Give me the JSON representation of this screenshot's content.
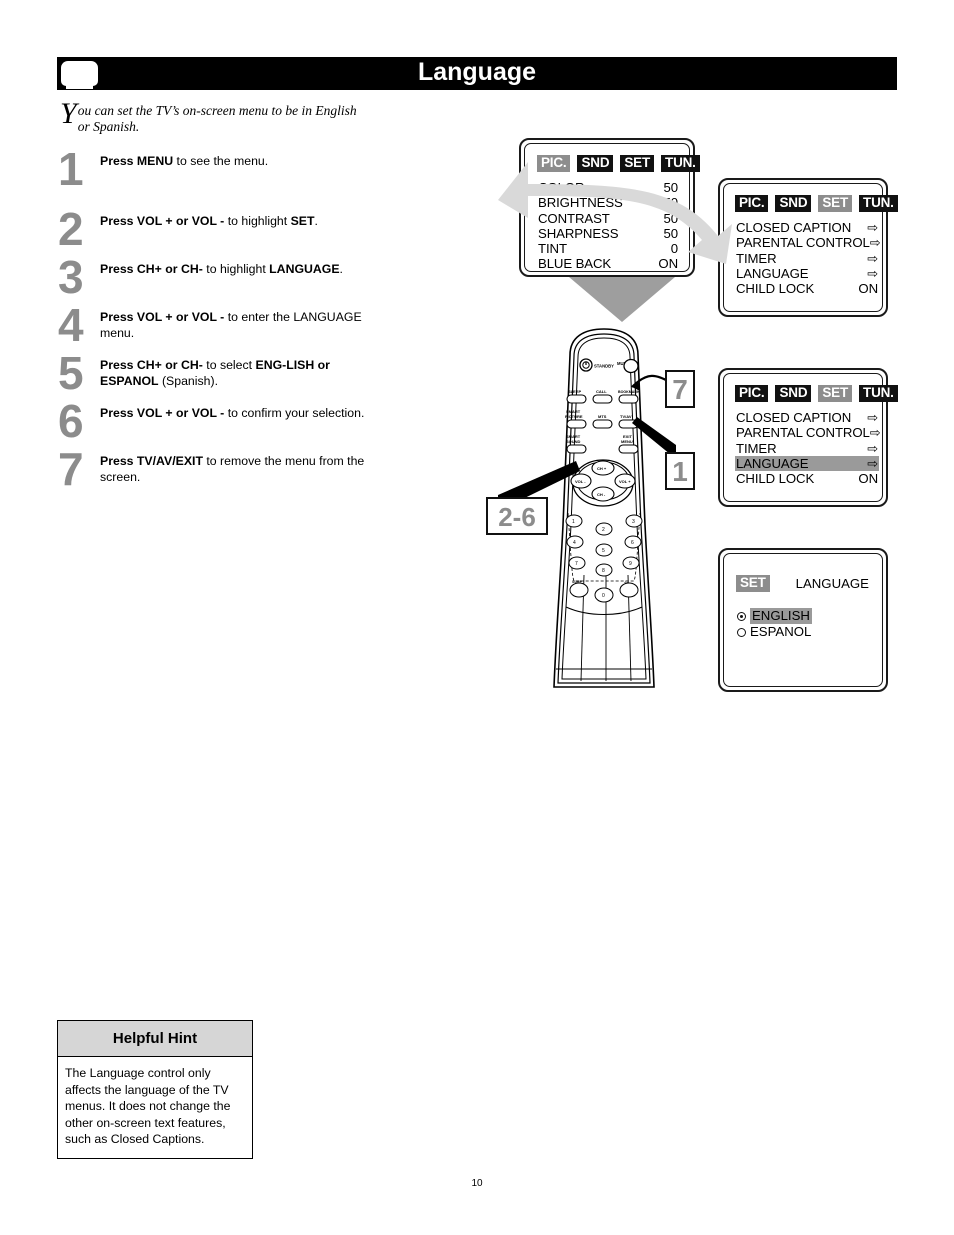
{
  "header": {
    "title": "Language",
    "tv_icon": "tv-icon"
  },
  "intro": {
    "dropcap": "Y",
    "text": "ou can set the TV’s on-screen menu to be in English or Spanish."
  },
  "steps": [
    {
      "num": "1",
      "html": "<b>Press MENU</b> to see the menu."
    },
    {
      "num": "2",
      "html": "<b>Press VOL + or VOL -</b> to highlight <b>SET</b>."
    },
    {
      "num": "3",
      "html": "<b>Press CH+ or CH-</b> to highlight <b>LANGUAGE</b>."
    },
    {
      "num": "4",
      "html": "<b>Press VOL + or VOL -</b> to enter the LANGUAGE menu."
    },
    {
      "num": "5",
      "html": "<b>Press CH+ or CH-</b> to select <b>ENG-LISH or ESPANOL</b> (Spanish)."
    },
    {
      "num": "6",
      "html": "<b>Press VOL + or VOL -</b> to confirm your selection."
    },
    {
      "num": "7",
      "html": "<b>Press TV/AV/EXIT</b> to remove the menu from the screen."
    }
  ],
  "osd": {
    "tabs": [
      "PIC.",
      "SND",
      "SET",
      "TUN."
    ],
    "picture_menu": {
      "selected_tab": "PIC.",
      "rows": [
        {
          "label": "COLOR",
          "value": "50"
        },
        {
          "label": "BRIGHTNESS",
          "value": "50"
        },
        {
          "label": "CONTRAST",
          "value": "50"
        },
        {
          "label": "SHARPNESS",
          "value": "50"
        },
        {
          "label": "TINT",
          "value": "0"
        },
        {
          "label": "BLUE BACK",
          "value": "ON"
        }
      ]
    },
    "set_menu": {
      "selected_tab": "SET",
      "rows": [
        {
          "label": "CLOSED CAPTION",
          "value": "⇨"
        },
        {
          "label": "PARENTAL CONTROL",
          "value": "⇨"
        },
        {
          "label": "TIMER",
          "value": "⇨"
        },
        {
          "label": "LANGUAGE",
          "value": "⇨"
        },
        {
          "label": "CHILD LOCK",
          "value": "ON"
        }
      ],
      "highlighted_row": ""
    },
    "set_menu_highlighted": {
      "selected_tab": "SET",
      "rows": [
        {
          "label": "CLOSED CAPTION",
          "value": "⇨"
        },
        {
          "label": "PARENTAL CONTROL",
          "value": "⇨"
        },
        {
          "label": "TIMER",
          "value": "⇨"
        },
        {
          "label": "LANGUAGE",
          "value": "⇨"
        },
        {
          "label": "CHILD LOCK",
          "value": "ON"
        }
      ],
      "highlighted_row": "LANGUAGE"
    },
    "language_menu": {
      "tab": "SET",
      "title": "LANGUAGE",
      "options": [
        {
          "label": "ENGLISH",
          "selected": true
        },
        {
          "label": "ESPANOL",
          "selected": false
        }
      ]
    }
  },
  "callouts": [
    {
      "id": "callout-7",
      "label": "7"
    },
    {
      "id": "callout-1",
      "label": "1"
    },
    {
      "id": "callout-2-6",
      "label": "2-6"
    }
  ],
  "remote": {
    "top_buttons": [
      {
        "label": "STANDBY"
      },
      {
        "label": "MUTE"
      }
    ],
    "function_buttons": [
      {
        "label": "SLEEP"
      },
      {
        "label": "CALL"
      },
      {
        "label": "BOOKMARK"
      },
      {
        "label": "SMART PICTURE"
      },
      {
        "label": "MTS"
      },
      {
        "label": "TV/AV"
      },
      {
        "label": "SMART SOUND"
      },
      {
        "label": ""
      },
      {
        "label": "EXIT MENU"
      }
    ],
    "nav_buttons": [
      {
        "label": "CH +"
      },
      {
        "label": "VOL -"
      },
      {
        "label": "VOL +"
      },
      {
        "label": "CH -"
      }
    ],
    "keypad": [
      "1",
      "2",
      "3",
      "4",
      "5",
      "6",
      "7",
      "8",
      "9",
      "0"
    ],
    "keypad_side": [
      "SURF",
      "-/--"
    ]
  },
  "hint": {
    "heading": "Helpful Hint",
    "body": "The Language control only affects the language of the TV menus. It does not change the other on-screen text features, such as Closed Captions."
  },
  "footer": {
    "page_number": "10"
  },
  "colors": {
    "header_bg": "#000000",
    "header_text": "#ffffff",
    "step_number": "#8c8c8c",
    "highlight_gray": "#9a9a9a",
    "tab_black": "#111111",
    "tab_selected": "#8d8d8d",
    "hint_header_bg": "#d6d6d6",
    "flow_arrow": "#9e9e9e"
  }
}
